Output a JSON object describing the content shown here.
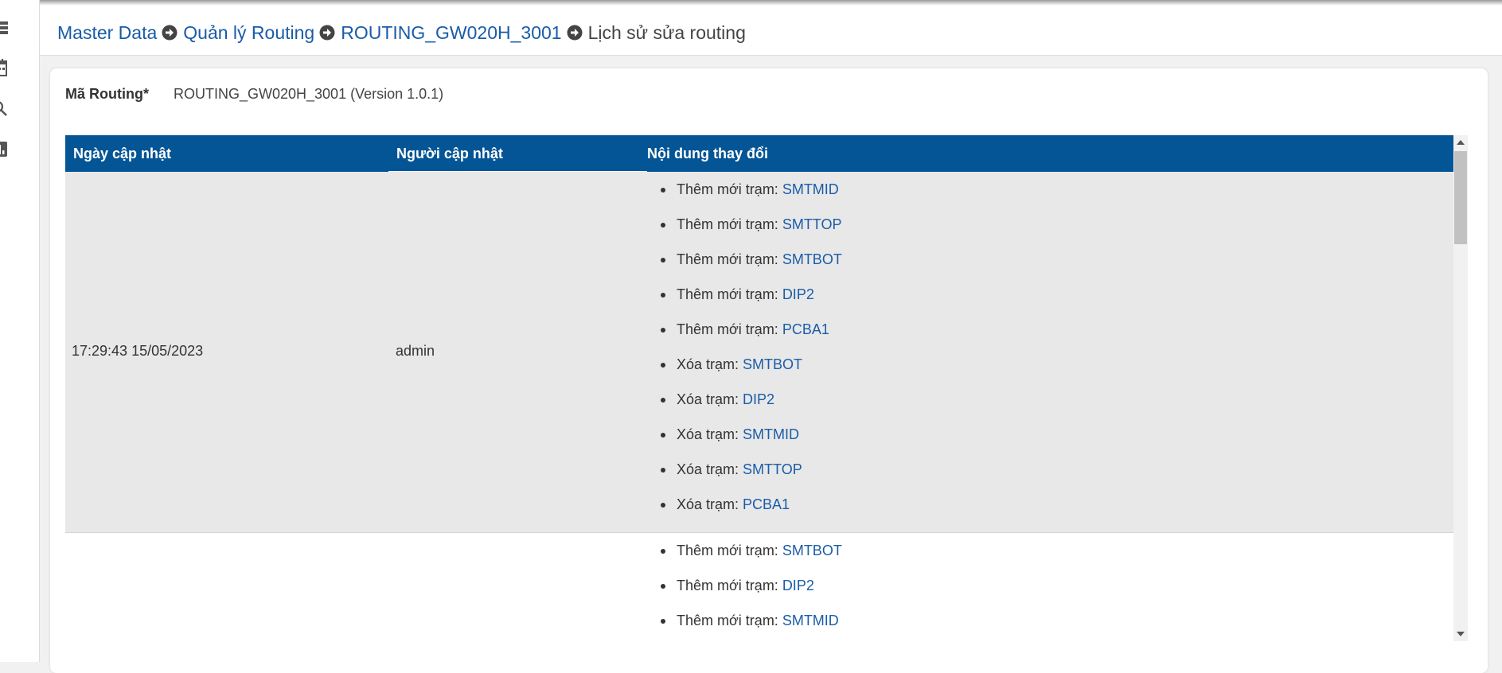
{
  "sidebar": {
    "icons": [
      "list-icon",
      "calendar-icon",
      "search-icon",
      "bar-chart-icon"
    ]
  },
  "breadcrumb": {
    "items": [
      "Master Data",
      "Quản lý Routing",
      "ROUTING_GW020H_3001",
      "Lịch sử sửa routing"
    ]
  },
  "routing": {
    "label": "Mã Routing*",
    "value": "ROUTING_GW020H_3001 (Version 1.0.1)"
  },
  "table": {
    "headers": [
      "Ngày cập nhật",
      "Người cập nhật",
      "Nội dung thay đổi"
    ],
    "rows": [
      {
        "date": "17:29:43 15/05/2023",
        "user": "admin",
        "changes": [
          {
            "action": "Thêm mới trạm: ",
            "station": "SMTMID"
          },
          {
            "action": "Thêm mới trạm: ",
            "station": "SMTTOP"
          },
          {
            "action": "Thêm mới trạm: ",
            "station": "SMTBOT"
          },
          {
            "action": "Thêm mới trạm: ",
            "station": "DIP2"
          },
          {
            "action": "Thêm mới trạm: ",
            "station": "PCBA1"
          },
          {
            "action": "Xóa trạm: ",
            "station": "SMTBOT"
          },
          {
            "action": "Xóa trạm: ",
            "station": "DIP2"
          },
          {
            "action": "Xóa trạm: ",
            "station": "SMTMID"
          },
          {
            "action": "Xóa trạm: ",
            "station": "SMTTOP"
          },
          {
            "action": "Xóa trạm: ",
            "station": "PCBA1"
          }
        ]
      },
      {
        "date": "",
        "user": "",
        "changes": [
          {
            "action": "Thêm mới trạm: ",
            "station": "SMTBOT"
          },
          {
            "action": "Thêm mới trạm: ",
            "station": "DIP2"
          },
          {
            "action": "Thêm mới trạm: ",
            "station": "SMTMID"
          }
        ]
      }
    ]
  },
  "colors": {
    "header_bg": "#045595",
    "link": "#1a5ca8",
    "row_alt_bg": "#e8e8e8"
  }
}
